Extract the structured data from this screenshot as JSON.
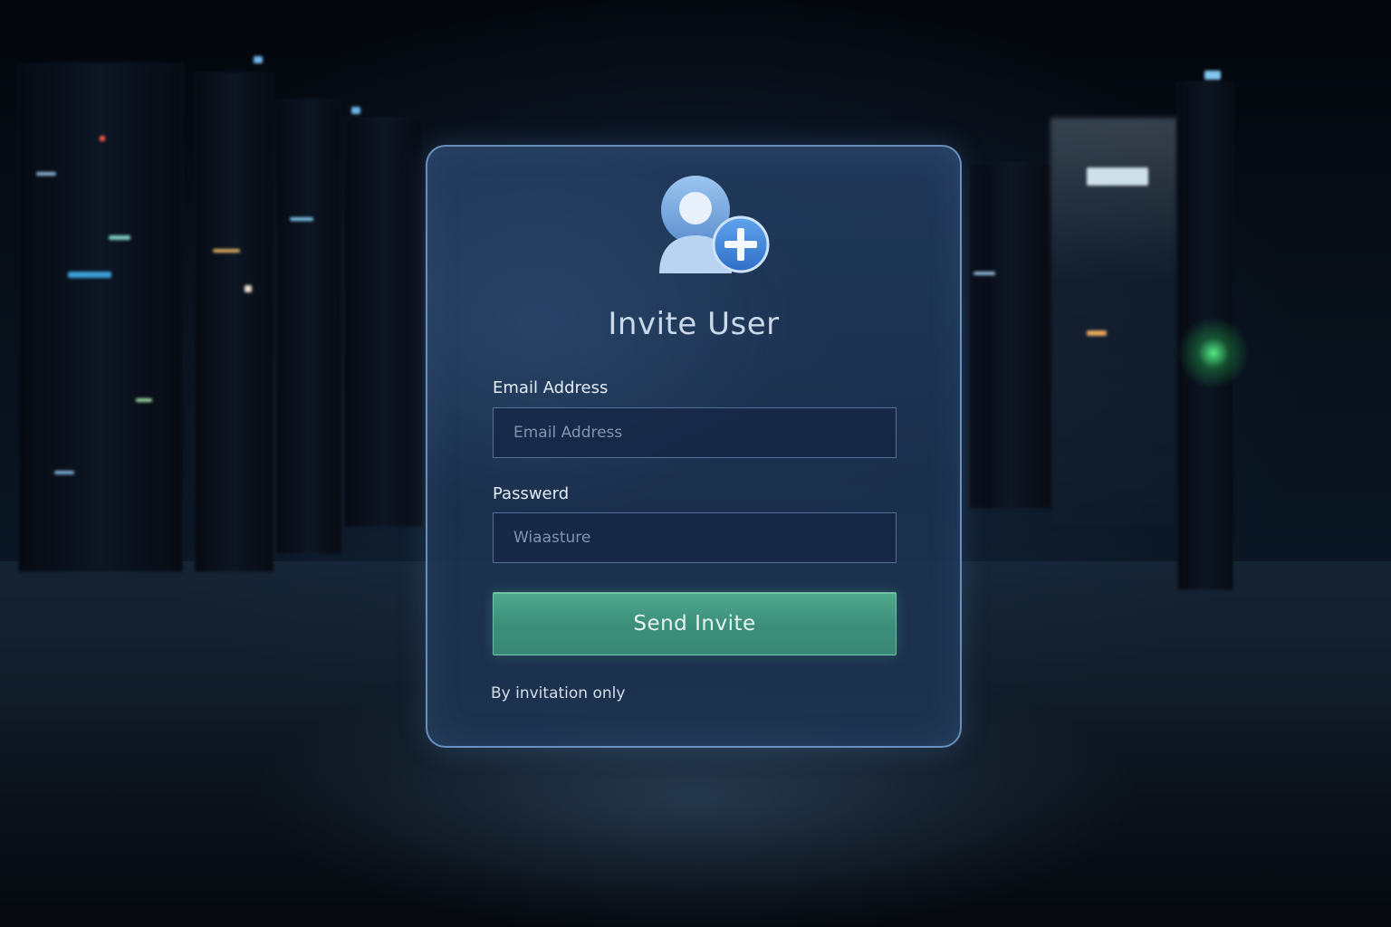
{
  "dialog": {
    "title": "Invite User",
    "email": {
      "label": "Email Address",
      "placeholder": "Email Address",
      "value": ""
    },
    "password": {
      "label": "Passwerd",
      "placeholder": "Wiaasture",
      "value": ""
    },
    "submit_label": "Send Invite",
    "footnote": "By invitation only",
    "icon": "add-user-icon"
  },
  "colors": {
    "accent_button": "#3f9a82",
    "card_border": "#82afe1",
    "background": "#05080f",
    "status_led_green": "#5aff8c"
  }
}
